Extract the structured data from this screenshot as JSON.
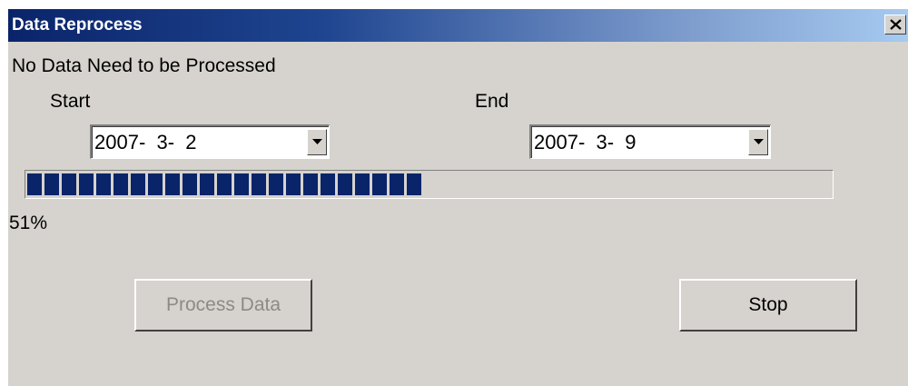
{
  "window": {
    "title": "Data Reprocess",
    "close_icon": "close-icon"
  },
  "status_text": "No Data Need to be Processed",
  "range": {
    "start_label": "Start",
    "start_value": "2007-  3-  2",
    "end_label": "End",
    "end_value": "2007-  3-  9"
  },
  "progress": {
    "fraction": 0.51,
    "text": "51%"
  },
  "buttons": {
    "process_label": "Process Data",
    "process_enabled": false,
    "stop_label": "Stop"
  },
  "colors": {
    "progress_block": "#0a246a",
    "dialog_face": "#d6d3ce",
    "disabled_text": "#8d8a85"
  }
}
